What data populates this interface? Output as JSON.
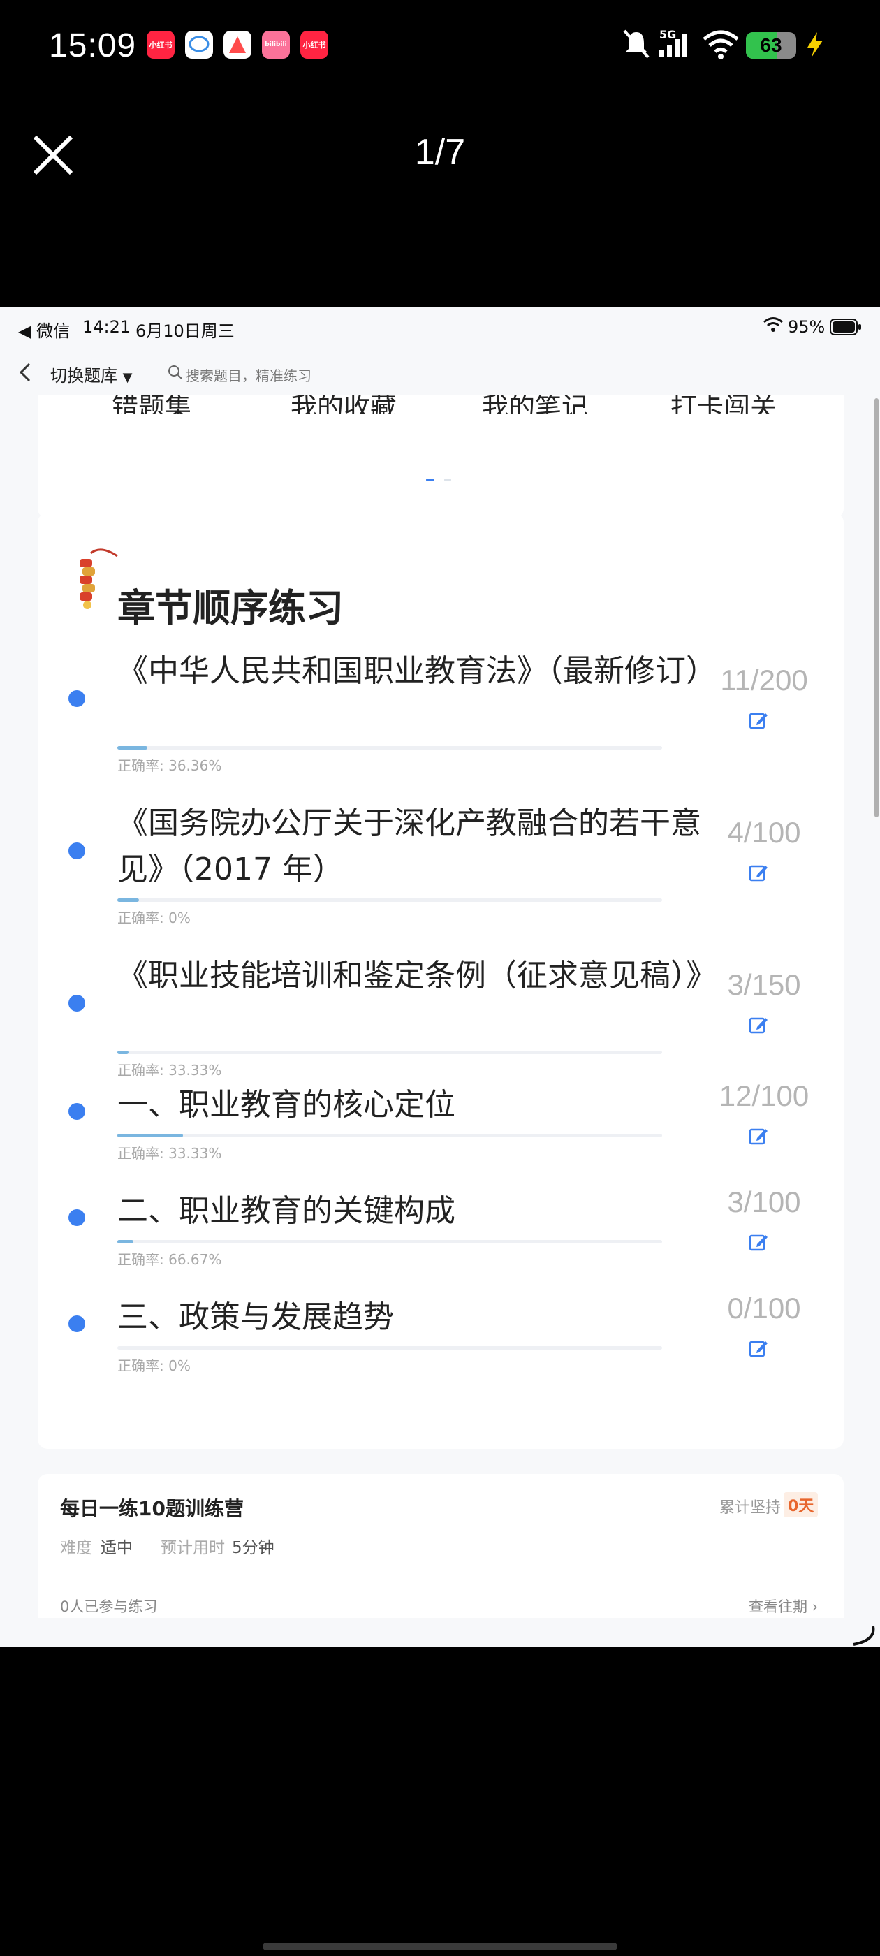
{
  "os_status": {
    "time": "15:09",
    "apps": [
      {
        "icon": "xiaohongshu-icon",
        "label": "小红书",
        "color": "#ff2442"
      },
      {
        "icon": "message-icon",
        "label": "",
        "color": "#ffffff"
      },
      {
        "icon": "app-a-icon",
        "label": "",
        "color": "#ff4b4b"
      },
      {
        "icon": "bilibili-icon",
        "label": "bilibili",
        "color": "#fb7299"
      },
      {
        "icon": "xiaohongshu-icon",
        "label": "小红书",
        "color": "#ff2442"
      }
    ],
    "network": "5G",
    "battery": "63",
    "battery_level": 63
  },
  "viewer": {
    "counter": "1/7"
  },
  "inner_status": {
    "back_app": "◀ 微信",
    "time": "14:21",
    "date": "6月10日周三",
    "battery": "95%"
  },
  "nav": {
    "switch_label": "切换题库",
    "search_placeholder": "搜索题目，精准练习"
  },
  "quick_links": [
    "错题集",
    "我的收藏",
    "我的笔记",
    "打卡闯关"
  ],
  "chapter": {
    "title": "章节顺序练习",
    "accuracy_prefix": "正确率: ",
    "rows": [
      {
        "title": "《中华人民共和国职业教育法》（最新修订）",
        "progress": "11/200",
        "done": 11,
        "total": 200,
        "accuracy": "36.36%"
      },
      {
        "title": "《国务院办公厅关于深化产教融合的若干意见》（2017 年）",
        "progress": "4/100",
        "done": 4,
        "total": 100,
        "accuracy": "0%"
      },
      {
        "title": "《职业技能培训和鉴定条例（征求意见稿）》",
        "progress": "3/150",
        "done": 3,
        "total": 150,
        "accuracy": "33.33%"
      },
      {
        "title": "一、职业教育的核心定位",
        "progress": "12/100",
        "done": 12,
        "total": 100,
        "accuracy": "33.33%"
      },
      {
        "title": "二、职业教育的关键构成",
        "progress": "3/100",
        "done": 3,
        "total": 100,
        "accuracy": "66.67%"
      },
      {
        "title": "三、政策与发展趋势",
        "progress": "0/100",
        "done": 0,
        "total": 100,
        "accuracy": "0%"
      }
    ]
  },
  "camp": {
    "title": "每日一练10题训练营",
    "streak_label": "累计坚持",
    "streak_value": "0天",
    "difficulty_label": "难度",
    "difficulty_value": "适中",
    "time_label": "预计用时",
    "time_value": "5分钟",
    "participants": "0人已参与练习",
    "history_link": "查看往期"
  }
}
